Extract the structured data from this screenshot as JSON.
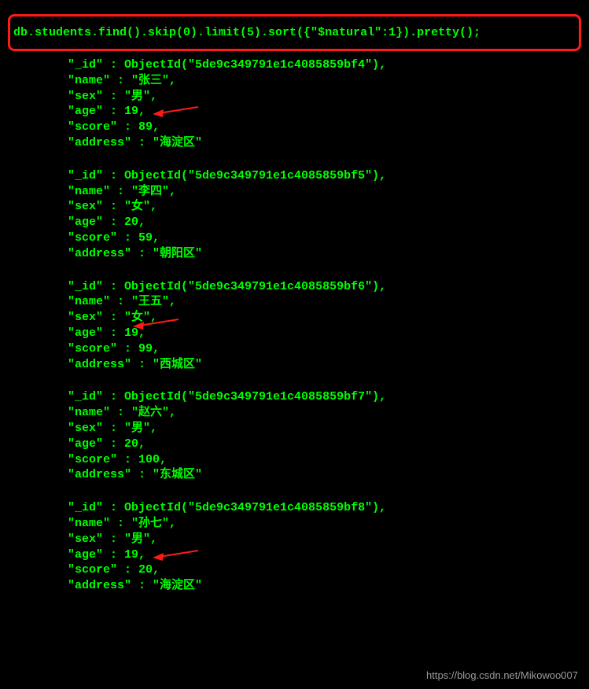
{
  "command": "db.students.find().skip(0).limit(5).sort({\"$natural\":1}).pretty();",
  "records": [
    {
      "oid": "5de9c349791e1c4085859bf4",
      "name": "张三",
      "sex": "男",
      "age": 19,
      "score": 89,
      "address": "海淀区",
      "arrow_on_age": true
    },
    {
      "oid": "5de9c349791e1c4085859bf5",
      "name": "李四",
      "sex": "女",
      "age": 20,
      "score": 59,
      "address": "朝阳区",
      "arrow_on_age": false
    },
    {
      "oid": "5de9c349791e1c4085859bf6",
      "name": "王五",
      "sex": "女",
      "age": 19,
      "score": 99,
      "address": "西城区",
      "arrow_on_age": true,
      "arrow_offset_line": "sex"
    },
    {
      "oid": "5de9c349791e1c4085859bf7",
      "name": "赵六",
      "sex": "男",
      "age": 20,
      "score": 100,
      "address": "东城区",
      "arrow_on_age": false
    },
    {
      "oid": "5de9c349791e1c4085859bf8",
      "name": "孙七",
      "sex": "男",
      "age": 19,
      "score": 20,
      "address": "海淀区",
      "arrow_on_age": true
    }
  ],
  "labels": {
    "id_key": "\"_id\"",
    "objectid_prefix": "ObjectId(\"",
    "objectid_suffix": "\")",
    "name_key": "\"name\"",
    "sex_key": "\"sex\"",
    "age_key": "\"age\"",
    "score_key": "\"score\"",
    "address_key": "\"address\""
  },
  "watermark": "https://blog.csdn.net/Mikowoo007",
  "colors": {
    "fg": "#00ff00",
    "bg": "#000000",
    "highlight_border": "#ff1a1a",
    "arrow": "#ff1a1a"
  }
}
